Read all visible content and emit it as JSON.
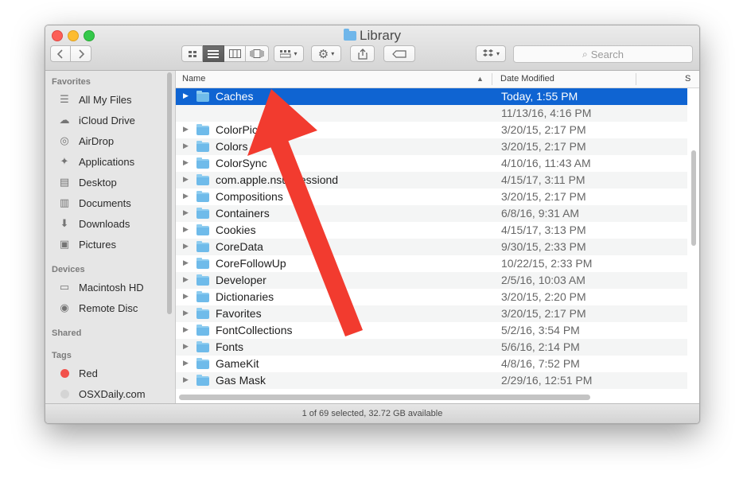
{
  "window": {
    "title": "Library",
    "status": "1 of 69 selected, 32.72 GB available"
  },
  "toolbar": {
    "back_icon": "chevron-left-icon",
    "forward_icon": "chevron-right-icon",
    "view_icons": [
      "icon-view-icon",
      "list-view-icon",
      "column-view-icon",
      "coverflow-view-icon"
    ],
    "search_placeholder": "Search",
    "search_icon": "⌕"
  },
  "sidebar": {
    "favorites_label": "Favorites",
    "favorites": [
      {
        "label": "All My Files",
        "icon": "all-files-icon",
        "glyph": "☰"
      },
      {
        "label": "iCloud Drive",
        "icon": "cloud-icon",
        "glyph": "☁"
      },
      {
        "label": "AirDrop",
        "icon": "airdrop-icon",
        "glyph": "◎"
      },
      {
        "label": "Applications",
        "icon": "applications-icon",
        "glyph": "✦"
      },
      {
        "label": "Desktop",
        "icon": "desktop-icon",
        "glyph": "▤"
      },
      {
        "label": "Documents",
        "icon": "documents-icon",
        "glyph": "▥"
      },
      {
        "label": "Downloads",
        "icon": "downloads-icon",
        "glyph": "⬇"
      },
      {
        "label": "Pictures",
        "icon": "pictures-icon",
        "glyph": "▣"
      }
    ],
    "devices_label": "Devices",
    "devices": [
      {
        "label": "Macintosh HD",
        "icon": "hard-disk-icon",
        "glyph": "▭"
      },
      {
        "label": "Remote Disc",
        "icon": "disc-icon",
        "glyph": "◉"
      }
    ],
    "shared_label": "Shared",
    "tags_label": "Tags",
    "tags": [
      {
        "label": "Red",
        "color": "#f2514b"
      },
      {
        "label": "OSXDaily.com",
        "color": "#d4d4d4"
      }
    ]
  },
  "list": {
    "col_name": "Name",
    "col_date": "Date Modified",
    "col_size": "S",
    "rows": [
      {
        "name": "Caches",
        "date": "Today, 1:55 PM",
        "selected": true
      },
      {
        "name": "",
        "date": "11/13/16, 4:16 PM"
      },
      {
        "name": "ColorPick",
        "date": "3/20/15, 2:17 PM"
      },
      {
        "name": "Colors",
        "date": "3/20/15, 2:17 PM"
      },
      {
        "name": "ColorSync",
        "date": "4/10/16, 11:43 AM"
      },
      {
        "name": "com.apple.nsurlsessiond",
        "date": "4/15/17, 3:11 PM"
      },
      {
        "name": "Compositions",
        "date": "3/20/15, 2:17 PM"
      },
      {
        "name": "Containers",
        "date": "6/8/16, 9:31 AM"
      },
      {
        "name": "Cookies",
        "date": "4/15/17, 3:13 PM"
      },
      {
        "name": "CoreData",
        "date": "9/30/15, 2:33 PM"
      },
      {
        "name": "CoreFollowUp",
        "date": "10/22/15, 2:33 PM"
      },
      {
        "name": "Developer",
        "date": "2/5/16, 10:03 AM"
      },
      {
        "name": "Dictionaries",
        "date": "3/20/15, 2:20 PM"
      },
      {
        "name": "Favorites",
        "date": "3/20/15, 2:17 PM"
      },
      {
        "name": "FontCollections",
        "date": "5/2/16, 3:54 PM"
      },
      {
        "name": "Fonts",
        "date": "5/6/16, 2:14 PM"
      },
      {
        "name": "GameKit",
        "date": "4/8/16, 7:52 PM"
      },
      {
        "name": "Gas Mask",
        "date": "2/29/16, 12:51 PM"
      }
    ]
  },
  "annotation": {
    "color": "#f23b2f"
  }
}
